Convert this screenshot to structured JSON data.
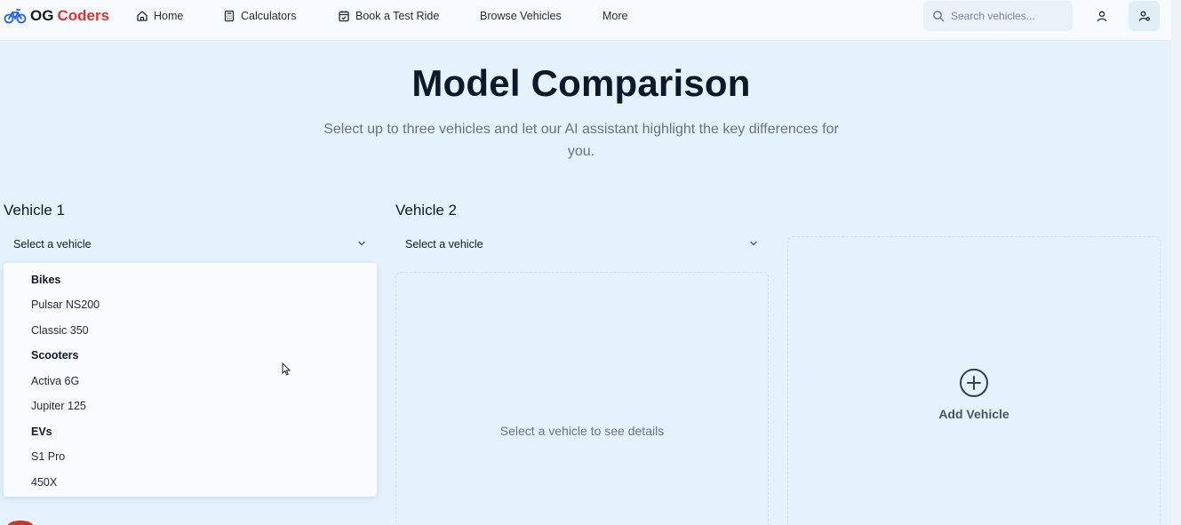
{
  "brand": {
    "name_part1": "OG",
    "name_part2": "Coders",
    "accent_color": "#e03131"
  },
  "nav": {
    "items": [
      {
        "label": "Home",
        "icon": "home-icon"
      },
      {
        "label": "Calculators",
        "icon": "calculator-icon"
      },
      {
        "label": "Book a Test Ride",
        "icon": "calendar-icon"
      },
      {
        "label": "Browse Vehicles"
      },
      {
        "label": "More"
      }
    ],
    "search_placeholder": "Search vehicles...",
    "actions": [
      "user-icon",
      "user-settings-icon"
    ]
  },
  "hero": {
    "title": "Model Comparison",
    "subtitle": "Select up to three vehicles and let our AI assistant highlight the key differences for you."
  },
  "vehicles": [
    {
      "label": "Vehicle 1",
      "select_value": "Select a vehicle"
    },
    {
      "label": "Vehicle 2",
      "select_value": "Select a vehicle",
      "empty_text": "Select a vehicle to see details"
    }
  ],
  "dropdown": {
    "groups": [
      {
        "label": "Bikes",
        "options": [
          "Pulsar NS200",
          "Classic 350"
        ]
      },
      {
        "label": "Scooters",
        "options": [
          "Activa 6G",
          "Jupiter 125"
        ]
      },
      {
        "label": "EVs",
        "options": [
          "S1 Pro",
          "450X"
        ]
      }
    ]
  },
  "add_vehicle": {
    "label": "Add Vehicle"
  }
}
